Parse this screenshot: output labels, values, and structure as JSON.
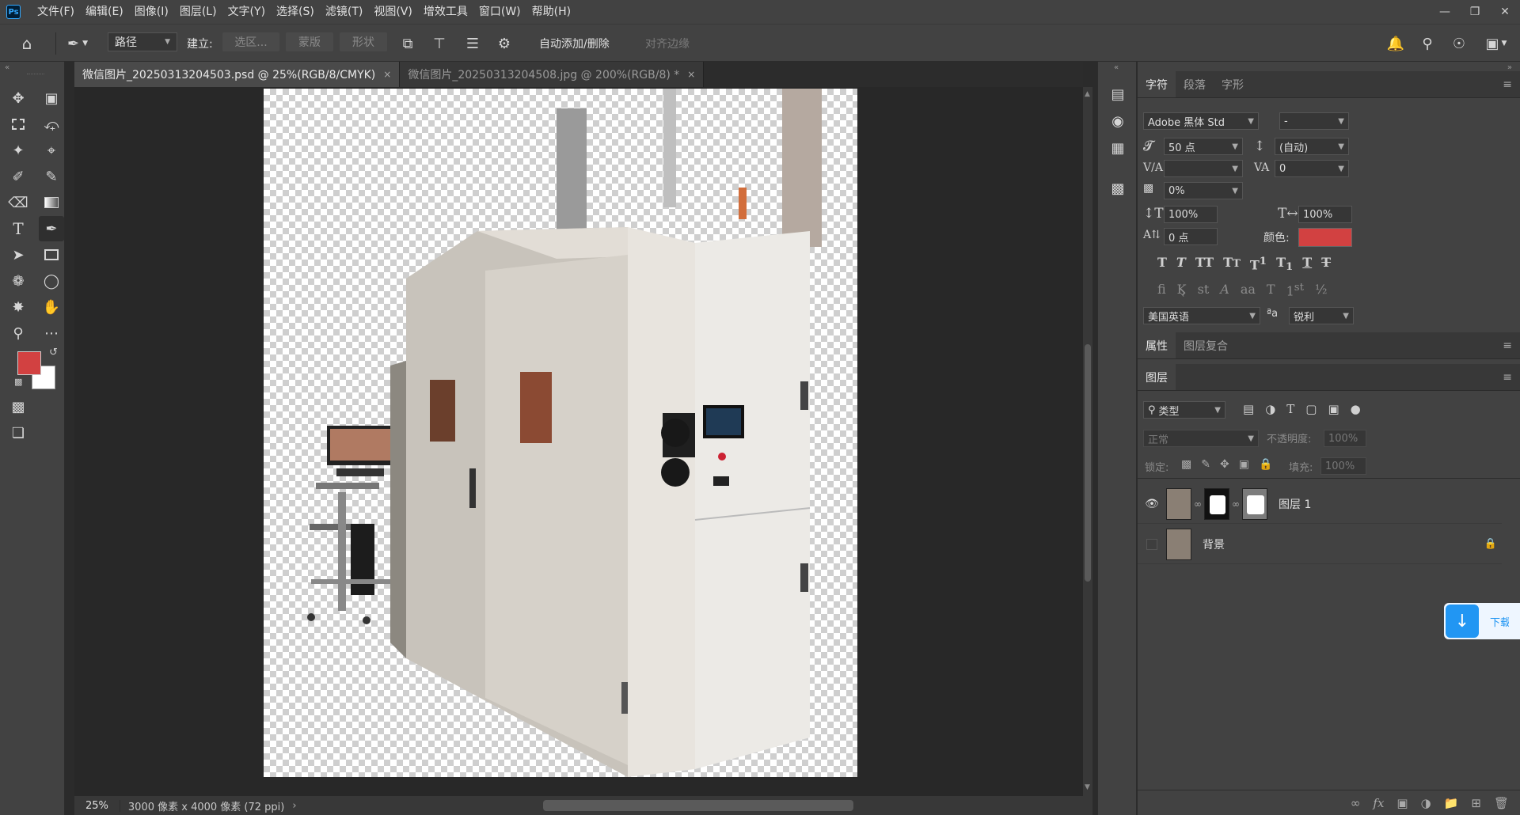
{
  "app": {
    "logo": "Ps"
  },
  "menu": [
    "文件(F)",
    "编辑(E)",
    "图像(I)",
    "图层(L)",
    "文字(Y)",
    "选择(S)",
    "滤镜(T)",
    "视图(V)",
    "增效工具",
    "窗口(W)",
    "帮助(H)"
  ],
  "options": {
    "mode": "路径",
    "make_label": "建立:",
    "selection_btn": "选区...",
    "mask_btn": "蒙版",
    "shape_btn": "形状",
    "auto_add_delete": "自动添加/删除",
    "align_edges": "对齐边缘"
  },
  "tabs": [
    {
      "label": "微信图片_20250313204503.psd @ 25%(RGB/8/CMYK)",
      "close": "×"
    },
    {
      "label": "微信图片_20250313204508.jpg @ 200%(RGB/8) *",
      "close": "×"
    }
  ],
  "status": {
    "zoom": "25%",
    "doc_info": "3000 像素 x 4000 像素 (72 ppi)",
    "arrow": "›"
  },
  "character_panel": {
    "tabs": [
      "字符",
      "段落",
      "字形"
    ],
    "font_family": "Adobe 黑体 Std",
    "font_style": "-",
    "font_size": "50 点",
    "leading": "(自动)",
    "kerning": "",
    "tracking": "0",
    "tsume": "0%",
    "vertical_scale": "100%",
    "horizontal_scale": "100%",
    "baseline_shift": "0 点",
    "color_label": "颜色:",
    "color": "#d24141",
    "language": "美国英语",
    "antialias_label": "ªa",
    "antialias": "锐利"
  },
  "properties_tabs": [
    "属性",
    "图层复合"
  ],
  "layers_panel": {
    "title": "图层",
    "filter_kind": "类型",
    "blend_mode": "正常",
    "opacity_label": "不透明度:",
    "opacity": "100%",
    "lock_label": "锁定:",
    "fill_label": "填充:",
    "fill": "100%",
    "layers": [
      {
        "name": "图层 1",
        "visible": true
      },
      {
        "name": "背景",
        "visible": false,
        "locked": true
      }
    ]
  },
  "download_widget": {
    "label": "下载"
  },
  "colors": {
    "foreground": "#d24141",
    "background": "#ffffff",
    "accent": "#31a8ff"
  }
}
